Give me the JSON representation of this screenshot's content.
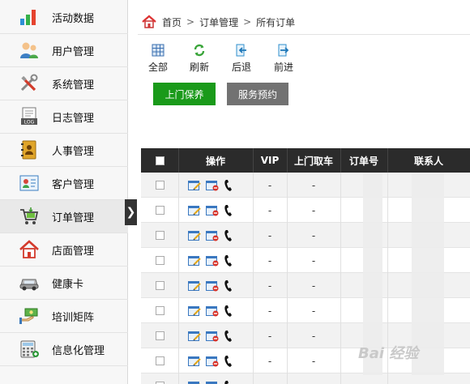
{
  "sidebar": {
    "items": [
      {
        "label": "活动数据",
        "icon": "bar-chart-icon"
      },
      {
        "label": "用户管理",
        "icon": "users-icon"
      },
      {
        "label": "系统管理",
        "icon": "tools-icon"
      },
      {
        "label": "日志管理",
        "icon": "log-icon"
      },
      {
        "label": "人事管理",
        "icon": "address-book-icon"
      },
      {
        "label": "客户管理",
        "icon": "customer-card-icon"
      },
      {
        "label": "订单管理",
        "icon": "cart-icon"
      },
      {
        "label": "店面管理",
        "icon": "house-icon"
      },
      {
        "label": "健康卡",
        "icon": "car-icon"
      },
      {
        "label": "培训矩阵",
        "icon": "money-hand-icon"
      },
      {
        "label": "信息化管理",
        "icon": "calculator-icon"
      }
    ],
    "active_index": 6,
    "collapse_glyph": "❯"
  },
  "breadcrumb": {
    "home": "首页",
    "sep": ">",
    "level1": "订单管理",
    "level2": "所有订单"
  },
  "toolbar": {
    "all": "全部",
    "refresh": "刷新",
    "back": "后退",
    "forward": "前进"
  },
  "buttons": {
    "onsite": "上门保养",
    "booking": "服务预约"
  },
  "table": {
    "headers": {
      "actions": "操作",
      "vip": "VIP",
      "pickup": "上门取车",
      "order_no": "订单号",
      "contact": "联系人"
    },
    "rows": [
      {
        "vip": "-",
        "pickup": "-"
      },
      {
        "vip": "-",
        "pickup": "-"
      },
      {
        "vip": "-",
        "pickup": "-"
      },
      {
        "vip": "-",
        "pickup": "-"
      },
      {
        "vip": "-",
        "pickup": "-"
      },
      {
        "vip": "-",
        "pickup": "-"
      },
      {
        "vip": "-",
        "pickup": "-"
      },
      {
        "vip": "-",
        "pickup": "-"
      },
      {
        "vip": "-",
        "pickup": "-"
      }
    ]
  },
  "colors": {
    "primary_green": "#1a9a1a",
    "secondary_gray": "#727272",
    "header_dark": "#2b2b2b"
  },
  "watermark": "Bai 经验"
}
